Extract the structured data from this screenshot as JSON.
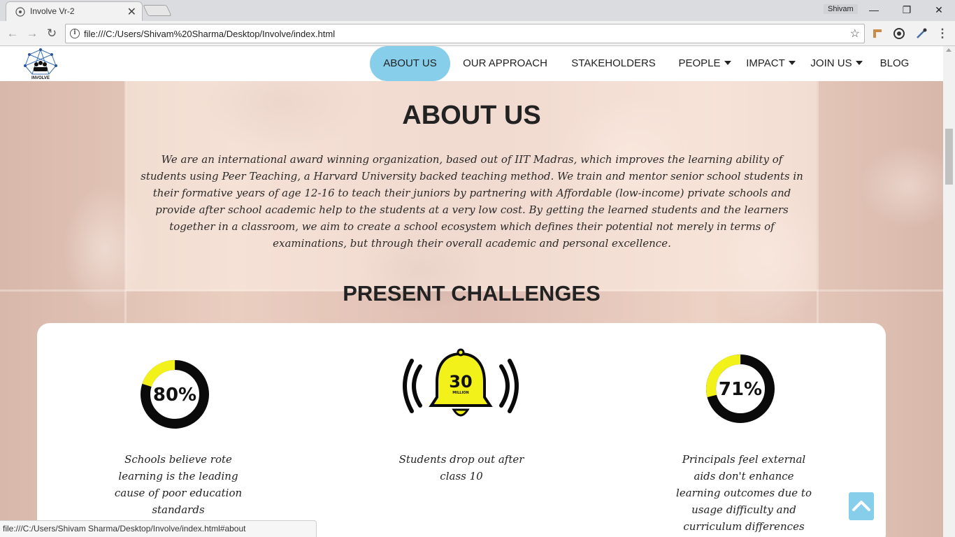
{
  "browser": {
    "tab_title": "Involve Vr-2",
    "tab_close": "✕",
    "profile_name": "Shivam",
    "url": "file:///C:/Users/Shivam%20Sharma/Desktop/Involve/index.html",
    "status_url": "file:///C:/Users/Shivam Sharma/Desktop/Involve/index.html#about",
    "window_controls": [
      "—",
      "❐",
      "✕"
    ]
  },
  "nav": {
    "items": [
      {
        "label": "ABOUT US",
        "active": true
      },
      {
        "label": "OUR APPROACH"
      },
      {
        "label": "STAKEHOLDERS"
      },
      {
        "label": "PEOPLE",
        "dropdown": true
      },
      {
        "label": "IMPACT",
        "dropdown": true
      },
      {
        "label": "JOIN US",
        "dropdown": true
      },
      {
        "label": "BLOG"
      }
    ],
    "logo_text": "INVOLVE"
  },
  "about": {
    "title": "ABOUT US",
    "text": "We are an international award winning organization, based out of IIT Madras, which improves the learning ability of students using Peer Teaching, a Harvard University backed teaching method. We train and mentor senior school students in their formative years of age 12-16 to teach their juniors by partnering with Affordable (low-income) private schools and provide after school academic help to the students at a very low cost. By getting the learned students and the learners together in a classroom, we aim to create a school ecosystem which defines their potential not merely in terms of examinations, but through their overall academic and personal excellence."
  },
  "challenges": {
    "title": "PRESENT CHALLENGES",
    "stats": [
      {
        "value_text": "80%",
        "fraction": 0.2,
        "caption": "Schools believe rote learning is the leading cause of poor education standards"
      },
      {
        "value_text": "30",
        "sub_text": "MILLION",
        "caption": "Students drop out after class 10"
      },
      {
        "value_text": "71%",
        "fraction": 0.29,
        "caption": "Principals feel external aids don't enhance learning outcomes due to usage difficulty and curriculum differences"
      }
    ]
  },
  "colors": {
    "accent": "#87ceeb",
    "stat_yellow": "#f2f21a",
    "ring_dark": "#0a0a0a"
  }
}
